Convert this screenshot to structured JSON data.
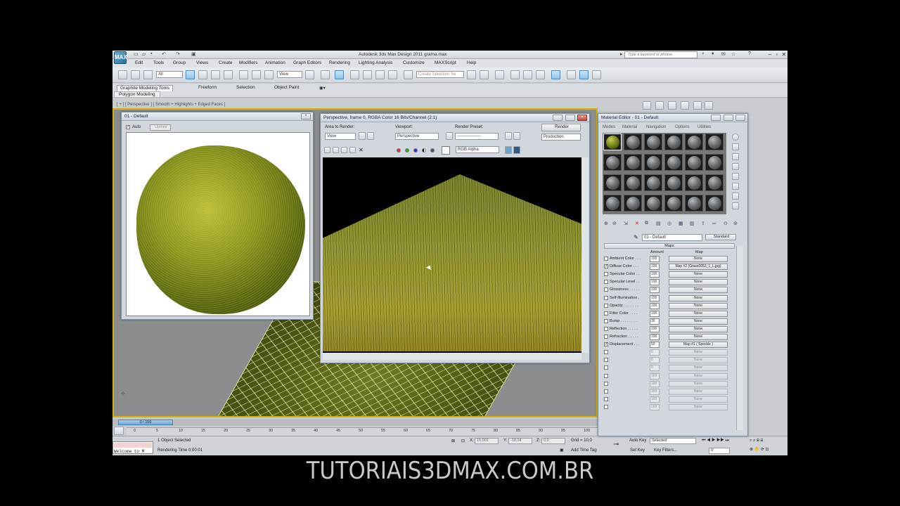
{
  "app": {
    "title": "Autodesk 3ds Max Design 2011       grama.max",
    "logo": "MAX",
    "search_placeholder": "Type a keyword or phrase"
  },
  "menu": [
    "Edit",
    "Tools",
    "Group",
    "Views",
    "Create",
    "Modifiers",
    "Animation",
    "Graph Editors",
    "Rendering",
    "Lighting Analysis",
    "Customize",
    "MAXScript",
    "Help"
  ],
  "toolbar": {
    "filter_value": "All",
    "ref_coord": "View",
    "selection_set_placeholder": "Create Selection Se"
  },
  "ribbon": {
    "tabs": [
      "Graphite Modeling Tools",
      "Freeform",
      "Selection",
      "Object Paint"
    ],
    "sub": "Polygon Modeling"
  },
  "viewport_label": "[ + ] [ Perspective ] [ Smooth + Highlights + Edged Faces ]",
  "material_preview": {
    "title": "01 - Default",
    "auto_label": "Auto",
    "update_label": "Update"
  },
  "render_window": {
    "title": "Perspective, frame 0, RGBA Color 16 Bits/Channel (2:1)",
    "area_label": "Area to Render:",
    "area_value": "View",
    "viewport_label": "Viewport:",
    "viewport_value": "Perspective",
    "preset_label": "Render Preset:",
    "preset_value": "-----------------",
    "render_button": "Render",
    "production_value": "Production",
    "channel_value": "RGB Alpha"
  },
  "material_editor": {
    "title": "Material Editor - 01 - Default",
    "menus": [
      "Modes",
      "Material",
      "Navigation",
      "Options",
      "Utilities"
    ],
    "material_name": "01 - Default",
    "type_button": "Standard",
    "rollout": "Maps",
    "col_amount": "Amount",
    "col_map": "Map",
    "maps": [
      {
        "name": "Ambient Color . . .",
        "checked": false,
        "amount": "100",
        "map": "None",
        "empty": false
      },
      {
        "name": "Diffuse Color . . .",
        "checked": true,
        "amount": "100",
        "map": "Map #2 (Grass0053_1_L.jpg)",
        "empty": false
      },
      {
        "name": "Specular Color . .",
        "checked": false,
        "amount": "100",
        "map": "None",
        "empty": false
      },
      {
        "name": "Specular Level . .",
        "checked": false,
        "amount": "100",
        "map": "None",
        "empty": false
      },
      {
        "name": "Glossiness . . . . .",
        "checked": false,
        "amount": "100",
        "map": "None",
        "empty": false
      },
      {
        "name": "Self-Illumination .",
        "checked": false,
        "amount": "100",
        "map": "None",
        "empty": false
      },
      {
        "name": "Opacity . . . . . . .",
        "checked": false,
        "amount": "100",
        "map": "None",
        "empty": false
      },
      {
        "name": "Filter Color . . . .",
        "checked": false,
        "amount": "100",
        "map": "None",
        "empty": false
      },
      {
        "name": "Bump . . . . . . . .",
        "checked": false,
        "amount": "30",
        "map": "None",
        "empty": false
      },
      {
        "name": "Reflection . . . . .",
        "checked": false,
        "amount": "100",
        "map": "None",
        "empty": false
      },
      {
        "name": "Refraction . . . . .",
        "checked": false,
        "amount": "100",
        "map": "None",
        "empty": false
      },
      {
        "name": "Displacement . . .",
        "checked": true,
        "amount": "50",
        "map": "Map #1 ( Speckle )",
        "empty": false
      },
      {
        "name": "",
        "checked": false,
        "amount": "0",
        "map": "None",
        "empty": true
      },
      {
        "name": "",
        "checked": false,
        "amount": "0",
        "map": "None",
        "empty": true
      },
      {
        "name": "",
        "checked": false,
        "amount": "0",
        "map": "None",
        "empty": true
      },
      {
        "name": "",
        "checked": false,
        "amount": "100",
        "map": "None",
        "empty": true
      },
      {
        "name": "",
        "checked": false,
        "amount": "100",
        "map": "None",
        "empty": true
      },
      {
        "name": "",
        "checked": false,
        "amount": "100",
        "map": "None",
        "empty": true
      },
      {
        "name": "",
        "checked": false,
        "amount": "100",
        "map": "None",
        "empty": true
      },
      {
        "name": "",
        "checked": false,
        "amount": "100",
        "map": "None",
        "empty": true
      }
    ]
  },
  "timeline": {
    "slider": "0 / 100",
    "ticks": [
      "0",
      "5",
      "10",
      "15",
      "20",
      "25",
      "30",
      "35",
      "40",
      "45",
      "50",
      "55",
      "60",
      "65",
      "70",
      "75",
      "80",
      "85",
      "90",
      "95",
      "100"
    ]
  },
  "status": {
    "selected": "1 Object Selected",
    "render_time": "Rendering Time  0:00:01",
    "command": "Welcome to M",
    "x_label": "X:",
    "x_value": "15,001",
    "y_label": "Y:",
    "y_value": "-18,04",
    "z_label": "Z:",
    "z_value": "0,0",
    "grid": "Grid = 10,0",
    "add_time_tag": "Add Time Tag",
    "auto_key": "Auto Key",
    "set_key": "Set Key",
    "selected_dd": "Selected",
    "key_filters": "Key Filters...",
    "frame": "0"
  },
  "watermark": "TUTORIAIS3DMAX.COM.BR"
}
